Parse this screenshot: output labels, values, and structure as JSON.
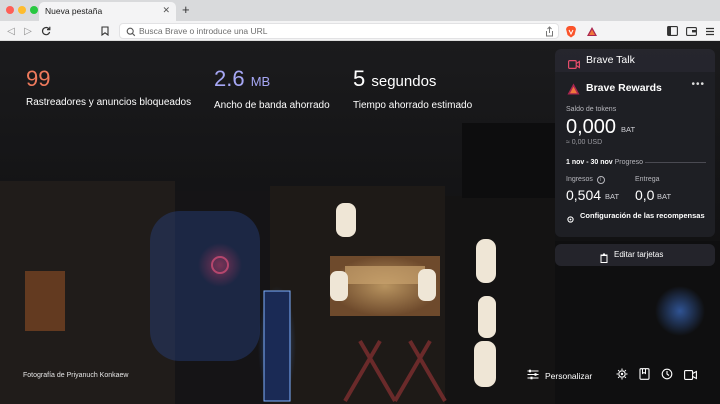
{
  "tab": {
    "title": "Nueva pestaña"
  },
  "url_bar": {
    "placeholder": "Busca Brave o introduce una URL"
  },
  "stats": [
    {
      "value": "99",
      "unit": "",
      "label": "Rastreadores y anuncios bloqueados",
      "color": "#ee7a5c"
    },
    {
      "value": "2.6",
      "unit": "MB",
      "label": "Ancho de banda ahorrado",
      "color": "#a6a7f5"
    },
    {
      "value": "5",
      "unit": "segundos",
      "label": "Tiempo ahorrado estimado",
      "color": "#ffffff"
    }
  ],
  "photo_credit": {
    "prefix": "Fotografía de",
    "author": "Priyanuch Konkaew"
  },
  "brave_talk": {
    "title": "Brave Talk"
  },
  "rewards": {
    "title": "Brave Rewards",
    "balance_label": "Saldo de tokens",
    "balance": "0,000",
    "balance_unit": "BAT",
    "usd": "≈ 0,00 USD",
    "period": "1 nov - 30 nov",
    "period_label": "Progreso",
    "income_label": "Ingresos",
    "income": "0,504",
    "income_unit": "BAT",
    "delivery_label": "Entrega",
    "delivery": "0,0",
    "delivery_unit": "BAT",
    "settings_label": "Configuración de las recompensas"
  },
  "edit_cards": {
    "label": "Editar tarjetas"
  },
  "customize": {
    "label": "Personalizar"
  },
  "colors": {
    "accent_red": "#fb542b",
    "brave_orange": "#ee7a5c",
    "talk_red": "#e54c6a"
  }
}
